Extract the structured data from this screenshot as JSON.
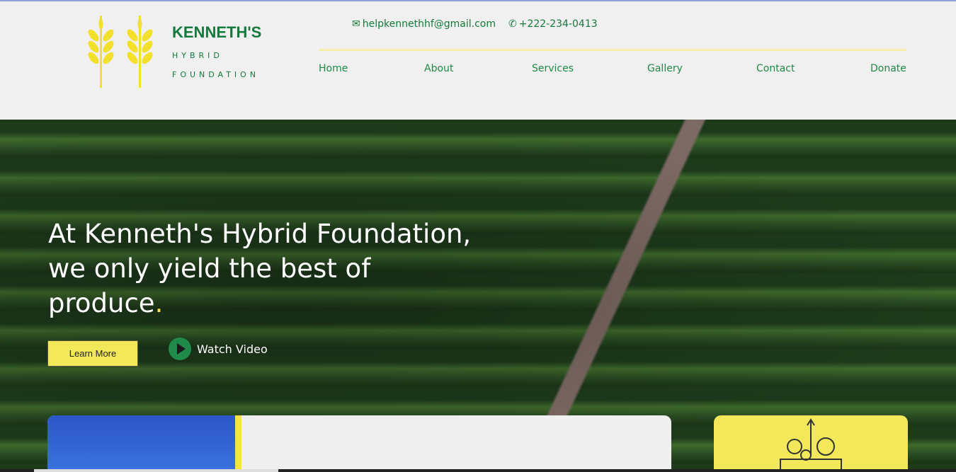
{
  "brand": {
    "name": "KENNETH'S",
    "line2": "HYBRID",
    "line3": "FOUNDATION",
    "logo_icon": "wheat-icon"
  },
  "contact": {
    "email": "helpkennethhf@gmail.com",
    "phone": "+222-234-0413"
  },
  "nav": [
    "Home",
    "About",
    "Services",
    "Gallery",
    "Contact",
    "Donate"
  ],
  "hero": {
    "headline": "At Kenneth's Hybrid Foundation, we only yield the best of produce",
    "headline_dot": ".",
    "learn_more": "Learn More",
    "watch_video": "Watch Video"
  },
  "colors": {
    "green": "#127a3a",
    "yellow": "#f3e75a"
  }
}
